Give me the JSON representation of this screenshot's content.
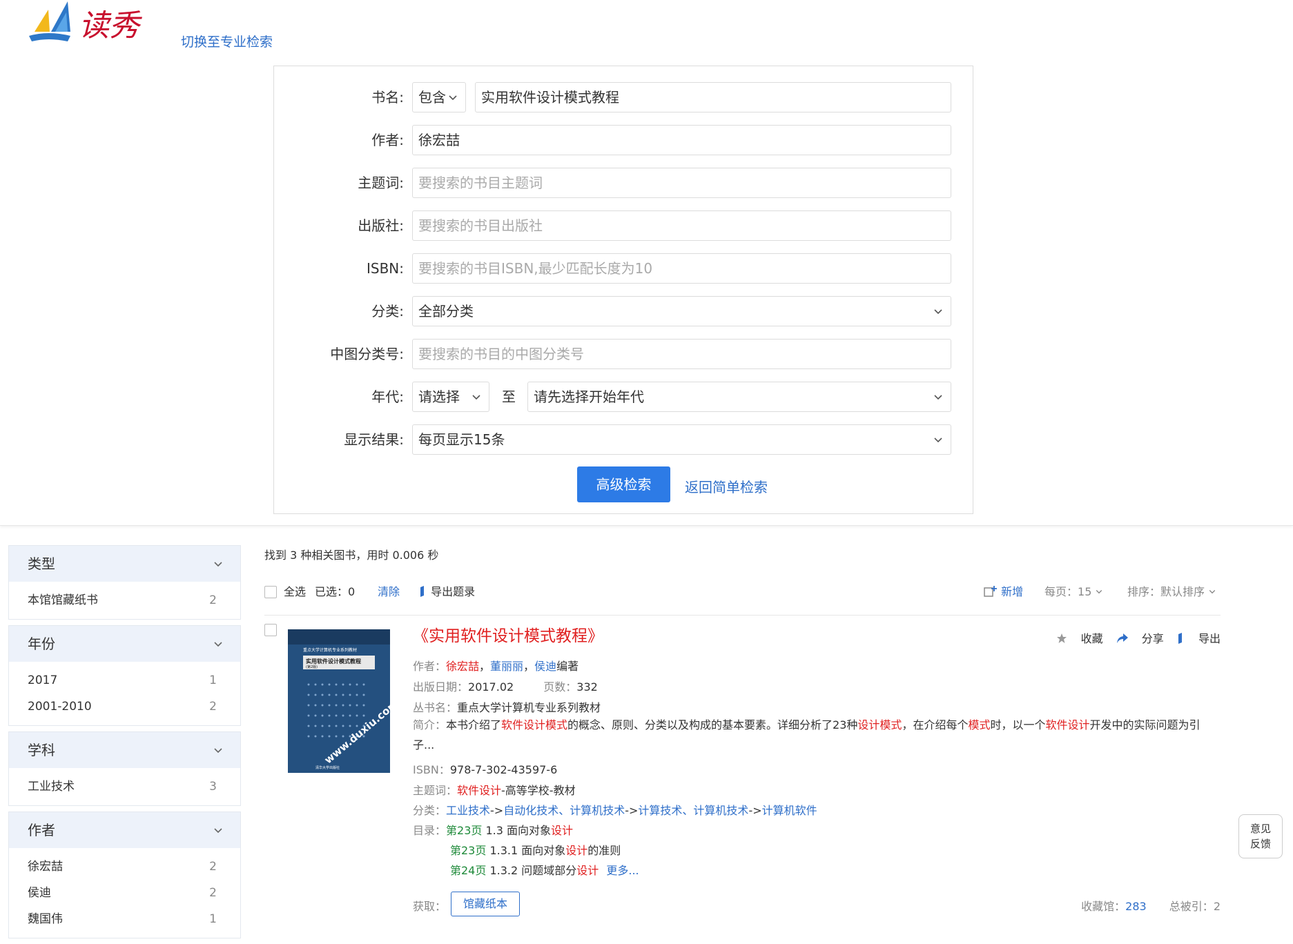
{
  "header": {
    "logo_text": "读秀",
    "switch_link": "切换至专业检索"
  },
  "form": {
    "title_label": "书名:",
    "title_match": "包含",
    "title_value": "实用软件设计模式教程",
    "author_label": "作者:",
    "author_value": "徐宏喆",
    "subject_label": "主题词:",
    "subject_placeholder": "要搜索的书目主题词",
    "publisher_label": "出版社:",
    "publisher_placeholder": "要搜索的书目出版社",
    "isbn_label": "ISBN:",
    "isbn_placeholder": "要搜索的书目ISBN,最少匹配长度为10",
    "category_label": "分类:",
    "category_value": "全部分类",
    "clc_label": "中图分类号:",
    "clc_placeholder": "要搜索的书目的中图分类号",
    "year_label": "年代:",
    "year_from": "请选择",
    "year_to_label": "至",
    "year_to": "请先选择开始年代",
    "display_label": "显示结果:",
    "display_value": "每页显示15条",
    "submit_label": "高级检索",
    "back_link": "返回简单检索"
  },
  "sidebar": {
    "facets": [
      {
        "title": "类型",
        "items": [
          {
            "label": "本馆馆藏纸书",
            "count": "2"
          }
        ]
      },
      {
        "title": "年份",
        "items": [
          {
            "label": "2017",
            "count": "1"
          },
          {
            "label": "2001-2010",
            "count": "2"
          }
        ]
      },
      {
        "title": "学科",
        "items": [
          {
            "label": "工业技术",
            "count": "3"
          }
        ]
      },
      {
        "title": "作者",
        "items": [
          {
            "label": "徐宏喆",
            "count": "2"
          },
          {
            "label": "侯迪",
            "count": "2"
          },
          {
            "label": "魏国伟",
            "count": "1"
          }
        ]
      }
    ]
  },
  "results": {
    "found_text": "找到 3 种相关图书，用时 0.006 秒",
    "select_all": "全选",
    "selected": "已选：0",
    "clear": "清除",
    "export_list": "导出题录",
    "add_new": "新增",
    "per_page_label": "每页：",
    "per_page_value": "15",
    "sort_label": "排序：",
    "sort_value": "默认排序"
  },
  "book": {
    "title": "《实用软件设计模式教程》",
    "action_fav": "收藏",
    "action_share": "分享",
    "action_export": "导出",
    "author_key": "作者：",
    "author1": "徐宏喆",
    "sep1": "，",
    "author2": "董丽丽",
    "sep2": "，",
    "author3": "侯迪",
    "author_suffix": "编著",
    "date_key": "出版日期：",
    "date_value": "2017.02",
    "pages_key": "页数：",
    "pages_value": "332",
    "series_key": "丛书名：",
    "series_value": "重点大学计算机专业系列教材",
    "summary_key": "简介：",
    "summary_p1": "本书介绍了",
    "summary_h1": "软件设计模式",
    "summary_p2": "的概念、原则、分类以及构成的基本要素。详细分析了23种",
    "summary_h2": "设计模式",
    "summary_p3": "，在介绍每个",
    "summary_h3": "模式",
    "summary_p4": "时，以一个",
    "summary_h4": "软件设计",
    "summary_p5": "开发中的实际问题为引子...",
    "isbn_key": "ISBN：",
    "isbn_value": "978-7-302-43597-6",
    "subject_key": "主题词：",
    "subject_h": "软件设计",
    "subject_rest": "-高等学校-教材",
    "class_key": "分类：",
    "class_1": "工业技术",
    "class_arrow1": "->",
    "class_2": "自动化技术、计算机技术",
    "class_arrow2": "->",
    "class_3": "计算技术、计算机技术",
    "class_arrow3": "->",
    "class_4": "计算机软件",
    "toc_key": "目录：",
    "toc": [
      {
        "page": "第23页",
        "text": " 1.3 面向对象",
        "hl": "设计",
        "tail": ""
      },
      {
        "page": "第23页",
        "text": " 1.3.1 面向对象",
        "hl": "设计",
        "tail": "的准则"
      },
      {
        "page": "第24页",
        "text": " 1.3.2 问题域部分",
        "hl": "设计",
        "tail": ""
      }
    ],
    "toc_more": "更多...",
    "obtain_key": "获取：",
    "obtain_btn": "馆藏纸本",
    "holdings_key": "收藏馆：",
    "holdings_value": "283",
    "cited_key": "总被引：",
    "cited_value": "2",
    "cover_series": "重点大学计算机专业系列教材",
    "cover_title": "实用软件设计模式教程",
    "cover_edition": "(第2版)",
    "cover_publisher": "清华大学出版社",
    "cover_watermark": "www.duxiu.com"
  },
  "feedback": {
    "line1": "意见",
    "line2": "反馈"
  },
  "colors": {
    "primary": "#2d7be6",
    "link": "#2f6fc9",
    "highlight": "#e02020",
    "toc_page": "#1f8a3a",
    "facet_head": "#edf2fa"
  }
}
